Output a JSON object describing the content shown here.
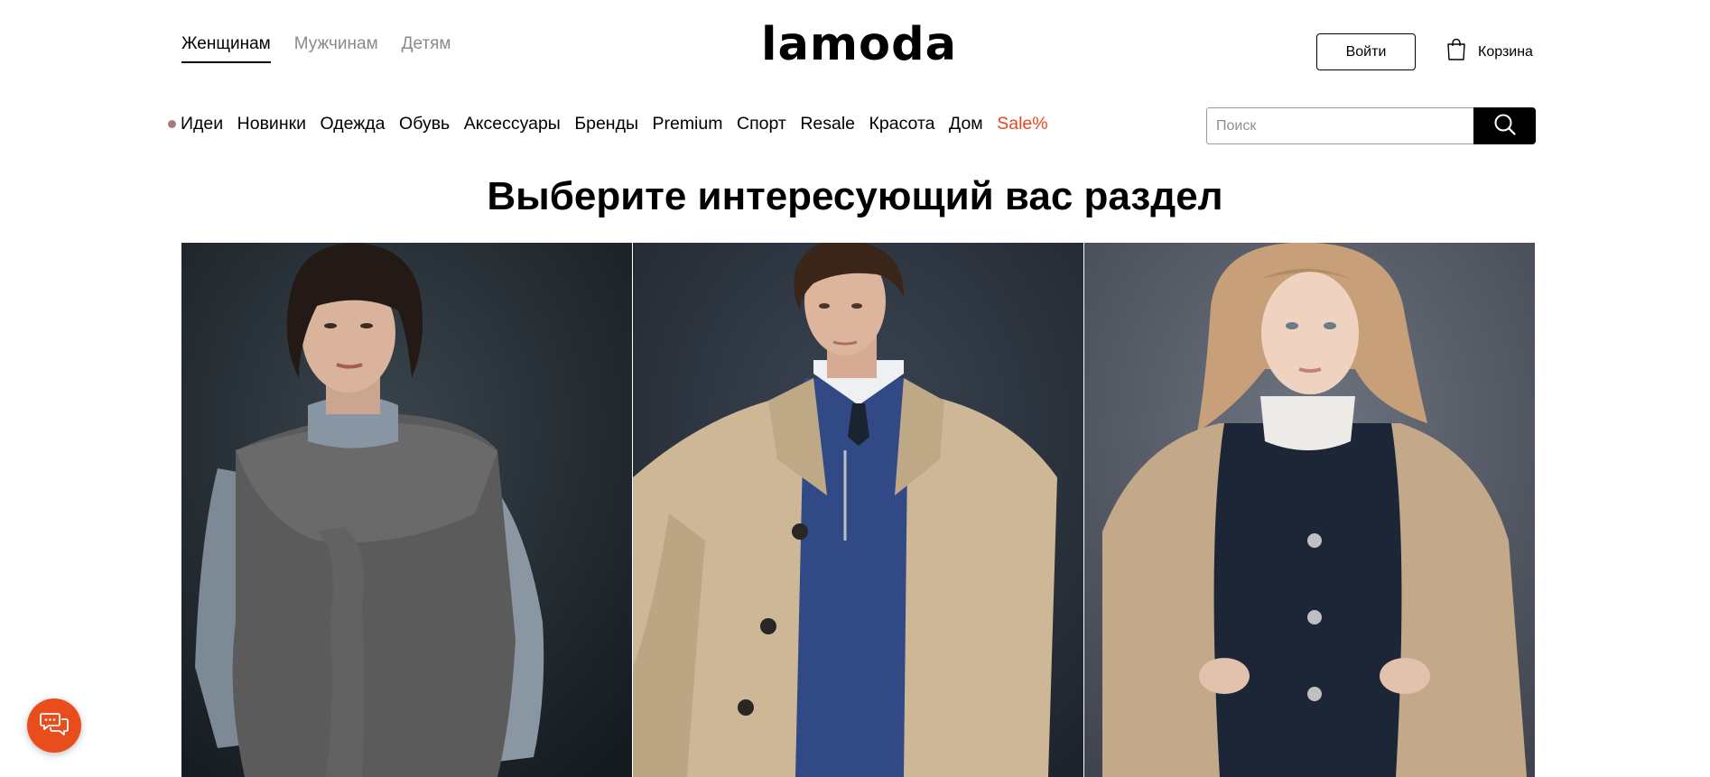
{
  "header": {
    "gender_tabs": [
      {
        "label": "Женщинам",
        "active": true
      },
      {
        "label": "Мужчинам",
        "active": false
      },
      {
        "label": "Детям",
        "active": false
      }
    ],
    "logo": "lamoda",
    "login_label": "Войти",
    "cart_label": "Корзина"
  },
  "nav": {
    "items": [
      {
        "label": "Идеи"
      },
      {
        "label": "Новинки"
      },
      {
        "label": "Одежда"
      },
      {
        "label": "Обувь"
      },
      {
        "label": "Аксессуары"
      },
      {
        "label": "Бренды"
      },
      {
        "label": "Premium"
      },
      {
        "label": "Спорт"
      },
      {
        "label": "Resale"
      },
      {
        "label": "Красота"
      },
      {
        "label": "Дом"
      },
      {
        "label": "Sale%"
      }
    ],
    "sale_color": "#e4491c",
    "ideas_dot_color": "#a87c77"
  },
  "search": {
    "placeholder": "Поиск",
    "value": ""
  },
  "main": {
    "title": "Выберите интересующий вас раздел",
    "tiles": [
      {
        "section": "women",
        "icon": "woman-photo"
      },
      {
        "section": "men",
        "icon": "man-photo"
      },
      {
        "section": "kids",
        "icon": "kid-photo"
      }
    ]
  },
  "chat": {
    "icon": "chat-icon",
    "color": "#ea4d1c"
  }
}
